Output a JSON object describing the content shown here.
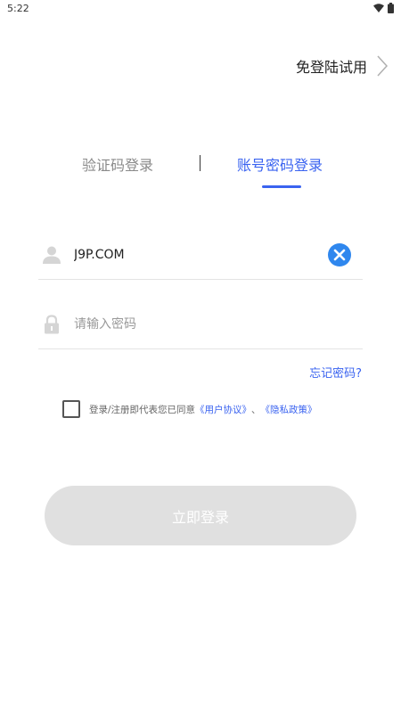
{
  "status_bar": {
    "time": "5:22",
    "icons": [
      "wifi-icon",
      "battery-icon"
    ]
  },
  "header": {
    "skip_login_label": "免登陆试用",
    "skip_icon": "chevron-right-icon"
  },
  "tabs": [
    {
      "label": "验证码登录",
      "active": false
    },
    {
      "label": "账号密码登录",
      "active": true
    }
  ],
  "form": {
    "username": {
      "value": "J9P.COM",
      "placeholder": "",
      "icon": "user-icon",
      "clear_icon": "clear-circle-icon"
    },
    "password": {
      "value": "",
      "placeholder": "请输入密码",
      "icon": "lock-icon"
    },
    "forgot_label": "忘记密码?"
  },
  "agreement": {
    "checked": false,
    "prefix": "登录/注册即代表您已同意",
    "user_agreement": "《用户协议》",
    "separator": "、",
    "privacy_policy": "《隐私政策》"
  },
  "submit_label": "立即登录",
  "colors": {
    "accent": "#3a63f0",
    "clear_button": "#2f87ee",
    "button_disabled": "#e0e0e0"
  }
}
